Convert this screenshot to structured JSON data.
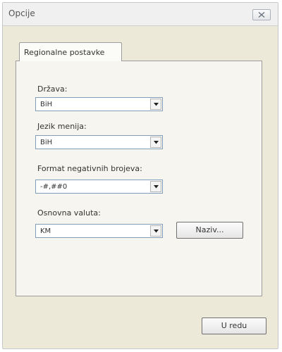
{
  "window": {
    "title": "Opcije",
    "close_icon": "close-icon"
  },
  "tabs": [
    {
      "label": "Regionalne postavke",
      "active": true
    }
  ],
  "fields": {
    "drzava": {
      "label": "Država:",
      "value": "BiH"
    },
    "jezik": {
      "label": "Jezik menija:",
      "value": "BiH"
    },
    "format": {
      "label": "Format negativnih brojeva:",
      "value": "-#,##0"
    },
    "valuta": {
      "label": "Osnovna valuta:",
      "value": "KM"
    }
  },
  "buttons": {
    "naziv": "Naziv...",
    "ok": "U redu"
  },
  "colors": {
    "dialog_bg": "#ece9d8",
    "panel_bg": "#f6f5ef",
    "combo_border": "#7f9db9"
  }
}
